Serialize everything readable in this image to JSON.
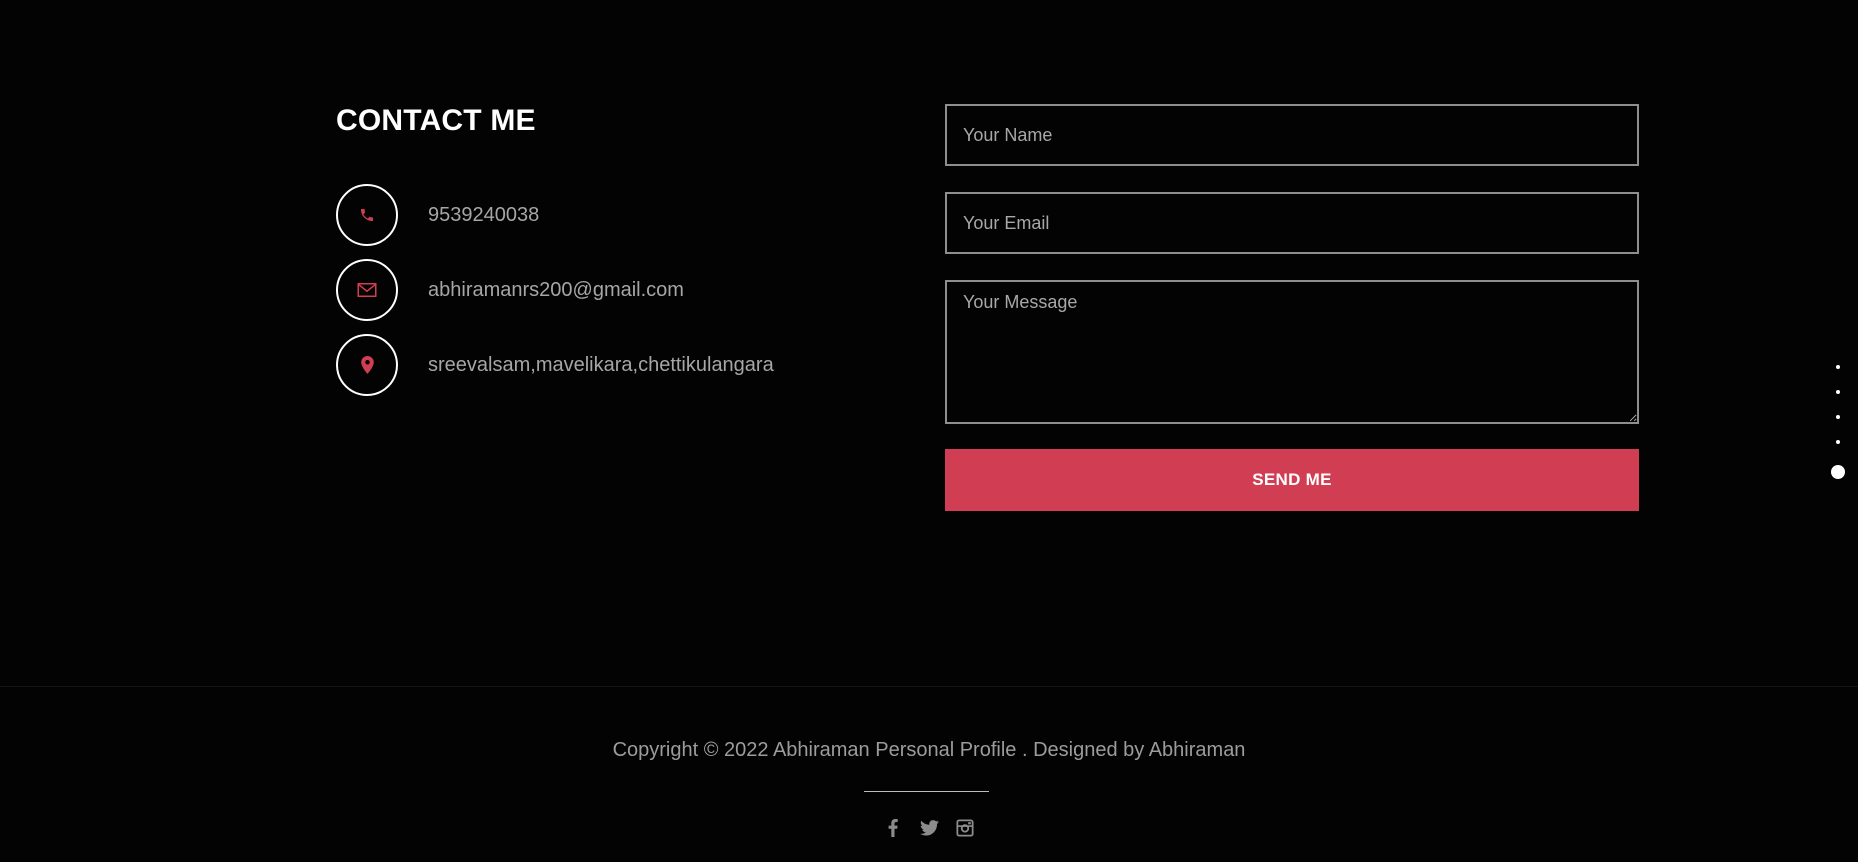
{
  "contact": {
    "title": "CONTACT ME",
    "items": [
      {
        "icon": "phone-icon",
        "text": "9539240038"
      },
      {
        "icon": "envelope-icon",
        "text": "abhiramanrs200@gmail.com"
      },
      {
        "icon": "map-marker-icon",
        "text": "sreevalsam,mavelikara,chettikulangara"
      }
    ]
  },
  "form": {
    "name_placeholder": "Your Name",
    "email_placeholder": "Your Email",
    "message_placeholder": "Your Message",
    "submit_label": "SEND ME"
  },
  "section_nav": {
    "dot_count": 5,
    "active_index": 4
  },
  "footer": {
    "copyright": "Copyright © 2022 Abhiraman Personal Profile . Designed by Abhiraman",
    "social": [
      "facebook-icon",
      "twitter-icon",
      "instagram-icon"
    ]
  },
  "colors": {
    "accent": "#d13d52",
    "background": "#030303",
    "text_muted": "#a6a6a6"
  }
}
